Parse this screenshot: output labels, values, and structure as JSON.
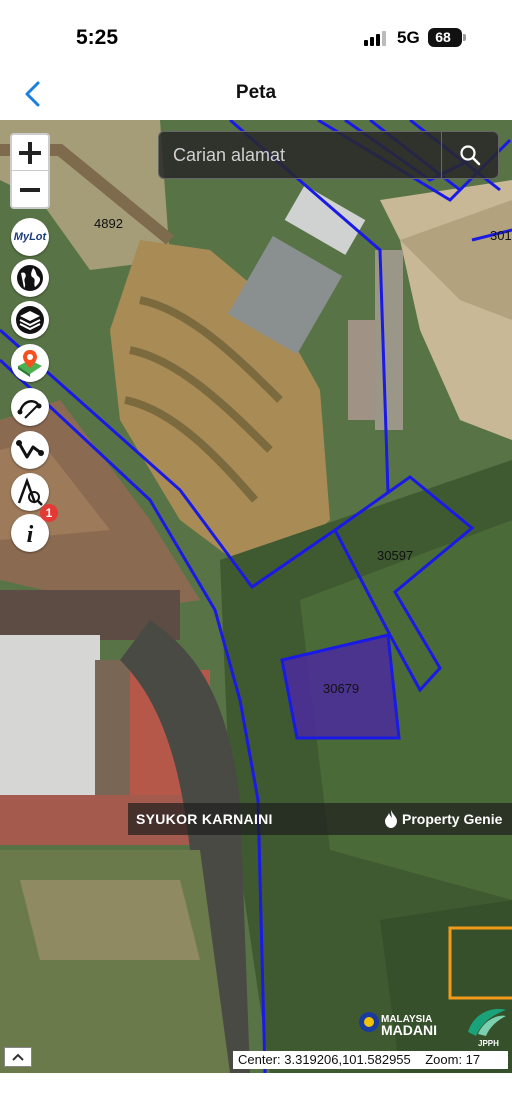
{
  "status_bar": {
    "time": "5:25",
    "network": "5G",
    "battery": "68"
  },
  "nav": {
    "title": "Peta"
  },
  "search": {
    "placeholder": "Carian alamat"
  },
  "map": {
    "lot_labels": [
      "4892",
      "301",
      "30597",
      "30679"
    ]
  },
  "tools": {
    "mylot_label": "MyLot",
    "info_badge_count": "1"
  },
  "watermark": {
    "agent": "SYUKOR KARNAINI",
    "brand": "Property Genie"
  },
  "logos": {
    "madani_line1": "MALAYSIA",
    "madani_line2": "MADANI",
    "jpem": "JPPH"
  },
  "coordinates": {
    "text": "Center: 3.319206,101.582955",
    "zoom_text": "Zoom: 17"
  },
  "colors": {
    "boundary": "#1a1ae6",
    "highlight_fill": "#4b2a9e",
    "orange_lot": "#f39a1a"
  }
}
